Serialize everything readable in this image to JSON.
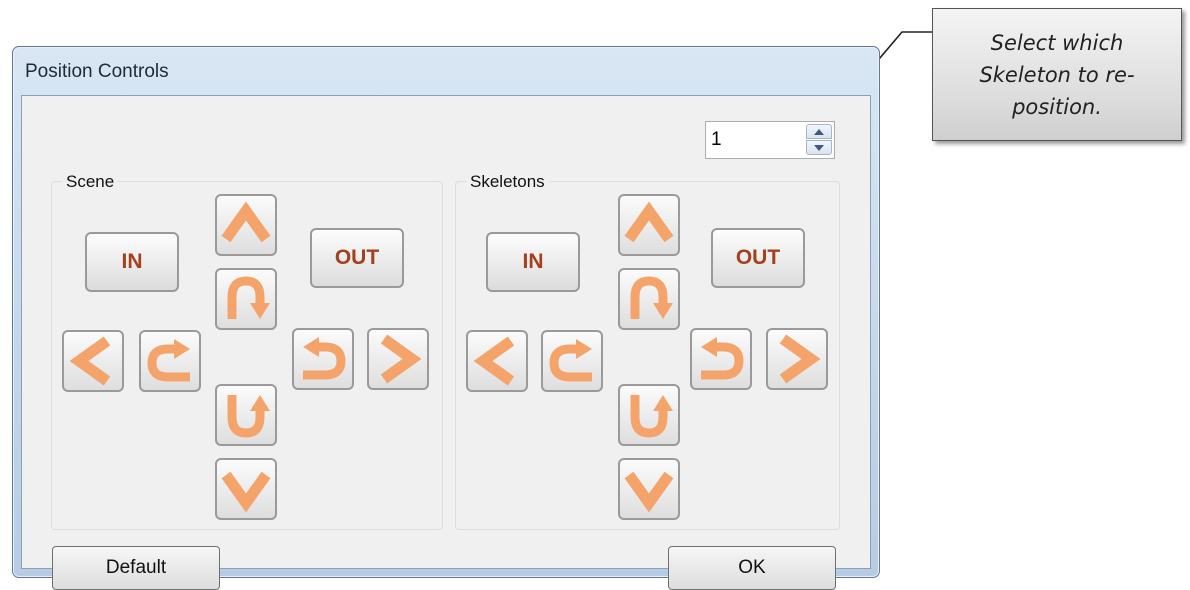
{
  "window": {
    "title": "Position Controls"
  },
  "scene": {
    "label": "Scene",
    "in_label": "IN",
    "out_label": "OUT"
  },
  "skeletons": {
    "label": "Skeletons",
    "in_label": "IN",
    "out_label": "OUT",
    "selected_skeleton": "1"
  },
  "footer": {
    "default_label": "Default",
    "ok_label": "OK"
  },
  "callout": {
    "text": "Select which Skeleton to re-position."
  },
  "icons": {
    "up": "chevron-up-icon",
    "down": "chevron-down-icon",
    "left": "chevron-left-icon",
    "right": "chevron-right-icon",
    "rotate_forward": "rotate-forward-icon",
    "rotate_back": "rotate-back-icon",
    "rotate_left": "rotate-left-icon",
    "rotate_right": "rotate-right-icon"
  },
  "colors": {
    "arrow_fill": "#f4a46a",
    "arrow_edge": "#f6c9a0",
    "in_out_text": "#a5401c"
  }
}
